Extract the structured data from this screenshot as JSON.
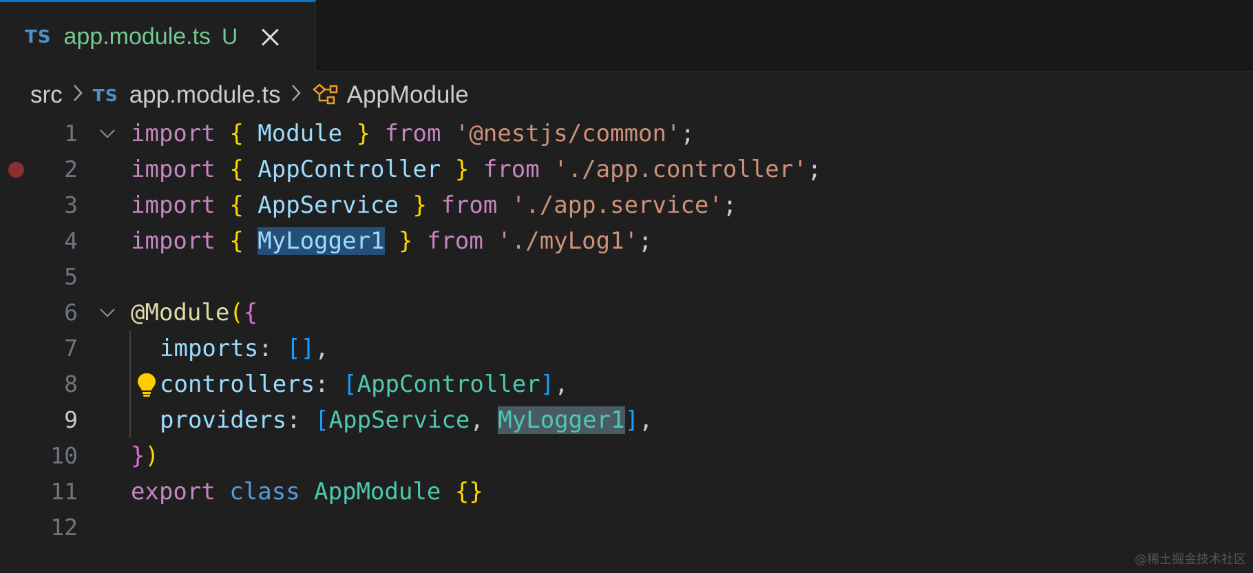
{
  "tab": {
    "badge": "TS",
    "filename": "app.module.ts",
    "status": "U"
  },
  "breadcrumb": {
    "folder": "src",
    "badge": "TS",
    "file": "app.module.ts",
    "symbol": "AppModule"
  },
  "editor": {
    "active_line": 9,
    "line_numbers": [
      "1",
      "2",
      "3",
      "4",
      "5",
      "6",
      "7",
      "8",
      "9",
      "10",
      "11",
      "12"
    ],
    "lines": {
      "l1": [
        "import",
        " ",
        "{",
        " ",
        "Module",
        " ",
        "}",
        " ",
        "from",
        " ",
        "'@nestjs/common'",
        ";"
      ],
      "l2": [
        "import",
        " ",
        "{",
        " ",
        "AppController",
        " ",
        "}",
        " ",
        "from",
        " ",
        "'./app.controller'",
        ";"
      ],
      "l3": [
        "import",
        " ",
        "{",
        " ",
        "AppService",
        " ",
        "}",
        " ",
        "from",
        " ",
        "'./app.service'",
        ";"
      ],
      "l4": [
        "import",
        " ",
        "{",
        " ",
        "MyLogger1",
        " ",
        "}",
        " ",
        "from",
        " ",
        "'./myLog1'",
        ";"
      ],
      "l6": [
        "@Module",
        "(",
        "{"
      ],
      "l7": [
        "imports",
        ": ",
        "[]",
        ","
      ],
      "l8": [
        "controllers",
        ": ",
        "[",
        "AppController",
        "]",
        ","
      ],
      "l9": [
        "providers",
        ": ",
        "[",
        "AppService",
        ", ",
        "MyLogger1",
        "]",
        ","
      ],
      "l10": [
        "}",
        ")"
      ],
      "l11": [
        "export",
        " ",
        "class",
        " ",
        "AppModule",
        " ",
        "{}"
      ]
    }
  },
  "watermark": "@稀土掘金技术社区",
  "icons": [
    "close-icon",
    "chevron-right-icon",
    "class-symbol-icon",
    "fold-chevron-icon",
    "breakpoint-icon",
    "lightbulb-icon"
  ],
  "colors": {
    "keyword_control": "#c586c0",
    "keyword": "#569cd6",
    "string": "#ce9178",
    "variable": "#9cdcfe",
    "type": "#4ec9b0",
    "bracket_gold": "#ffd700",
    "bracket_orchid": "#da70d6",
    "bracket_blue": "#179fff",
    "git_untracked": "#73c991",
    "tab_active_border": "#0078d4",
    "breakpoint": "#8b2f2f",
    "lightbulb": "#ffcc00"
  }
}
